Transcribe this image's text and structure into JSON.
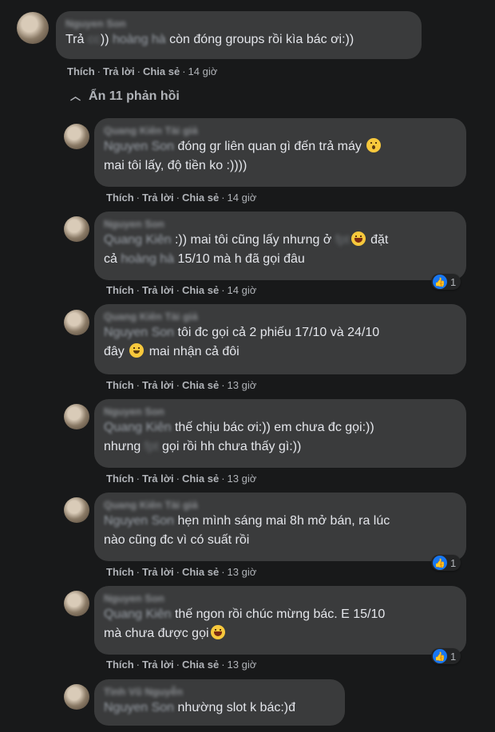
{
  "root_comment": {
    "author": "Nguyen Son",
    "mention1": "cc",
    "mention2": "hoàng hà",
    "prefix": "Trả",
    "part1": "))",
    "part2": "còn đóng groups rồi kìa bác ơi:))",
    "actions": {
      "like": "Thích",
      "reply": "Trả lời",
      "share": "Chia sẻ",
      "time": "14 giờ"
    }
  },
  "hide_replies": "Ẩn 11 phản hồi",
  "replies": [
    {
      "author": "Quang Kiên Tài giả",
      "mention": "Nguyen Son",
      "text1": "đóng gr liên quan gì đến trả máy",
      "emoji1": "wow",
      "text2": "mai tôi lấy, độ tiền ko :))))",
      "time": "14 giờ",
      "reactions": ""
    },
    {
      "author": "Nguyen Son",
      "mention": "Quang Kiên",
      "text1": ":)) mai tôi cũng lấy nhưng ở",
      "blur1": "fpt",
      "emoji1": "laugh",
      "text1b": "đặt",
      "text2a": "cả",
      "blur2": "hoàng hà",
      "text2": "15/10 mà h đã gọi đâu",
      "time": "14 giờ",
      "reactions": "1"
    },
    {
      "author": "Quang Kiên Tài giả",
      "mention": "Nguyen Son",
      "text1": "tôi đc gọi cả 2 phiếu 17/10 và 24/10",
      "text2a": "đây",
      "emoji2": "smile",
      "text2": "mai nhận cả đôi",
      "time": "13 giờ",
      "reactions": ""
    },
    {
      "author": "Nguyen Son",
      "mention": "Quang Kiên",
      "text1": "thế chịu bác ơi:)) em chưa đc gọi:))",
      "text2a": "nhưng",
      "blur2": "fpt",
      "text2": "gọi rồi hh chưa thấy gì:))",
      "time": "13 giờ",
      "reactions": ""
    },
    {
      "author": "Quang Kiên Tài giả",
      "mention": "Nguyen Son",
      "text1": "hẹn mình sáng mai 8h mở bán, ra lúc",
      "text2": "nào cũng đc vì có suất rồi",
      "time": "13 giờ",
      "reactions": "1"
    },
    {
      "author": "Nguyen Son",
      "mention": "Quang Kiên",
      "text1": "thế ngon rồi chúc mừng bác. E 15/10",
      "text2": "mà chưa được gọi",
      "emoji2": "laugh",
      "time": "13 giờ",
      "reactions": "1"
    },
    {
      "author": "Tình Vũ Nguyễn",
      "mention": "Nguyen Son",
      "text1": "nhường slot k bác:)",
      "text1c": "đ",
      "time": "",
      "reactions": ""
    }
  ],
  "labels": {
    "like": "Thích",
    "reply": "Trả lời",
    "share": "Chia sẻ"
  }
}
